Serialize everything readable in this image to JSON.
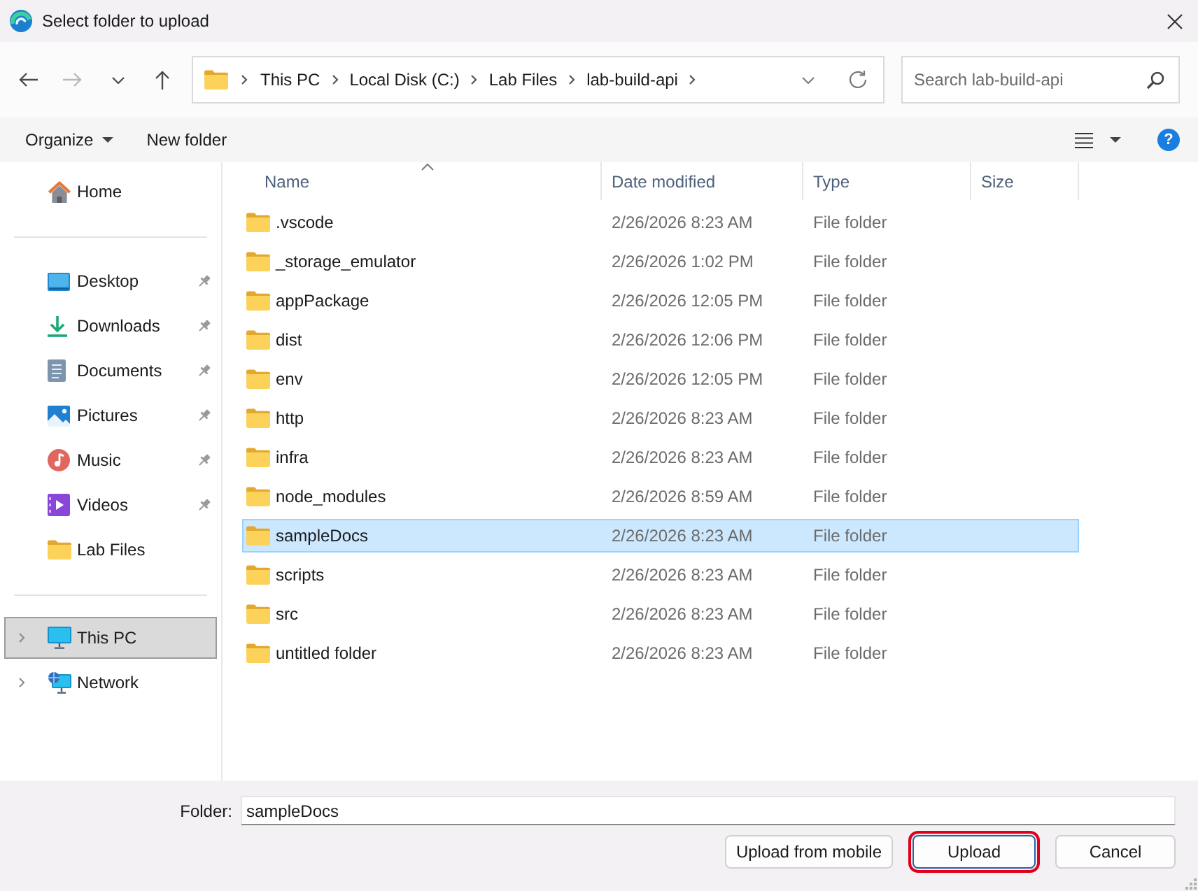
{
  "window": {
    "title": "Select folder to upload"
  },
  "nav_buttons": [
    {
      "kind": "back",
      "disabled": false
    },
    {
      "kind": "forward",
      "disabled": true
    },
    {
      "kind": "recent",
      "disabled": false
    },
    {
      "kind": "up",
      "disabled": false
    }
  ],
  "address_bar": {
    "breadcrumbs": [
      "This PC",
      "Local Disk (C:)",
      "Lab Files",
      "lab-build-api"
    ]
  },
  "search": {
    "placeholder": "Search lab-build-api"
  },
  "command_bar": {
    "items": [
      {
        "label": "Organize",
        "kind": "menu"
      },
      {
        "label": "New folder",
        "kind": "button"
      }
    ],
    "help": {
      "label": "?"
    }
  },
  "sidebar": {
    "sections": [
      {
        "items": [
          {
            "label": "Home",
            "selected": false
          }
        ]
      },
      {
        "items": [
          {
            "label": "Desktop",
            "pinned": true,
            "selected": false
          },
          {
            "label": "Downloads",
            "pinned": true,
            "selected": false
          },
          {
            "label": "Documents",
            "pinned": true,
            "selected": false
          },
          {
            "label": "Pictures",
            "pinned": true,
            "selected": false
          },
          {
            "label": "Music",
            "pinned": true,
            "selected": false
          },
          {
            "label": "Videos",
            "pinned": true,
            "selected": false
          },
          {
            "label": "Lab Files",
            "pinned": false,
            "selected": false
          }
        ]
      },
      {
        "items": [
          {
            "label": "This PC",
            "expanded": false,
            "selected": true
          },
          {
            "label": "Network",
            "expanded": false,
            "selected": false
          }
        ]
      }
    ]
  },
  "file_list": {
    "columns": [
      {
        "label": "Name",
        "sorted": true
      },
      {
        "label": "Date modified",
        "sorted": false
      },
      {
        "label": "Type",
        "sorted": false
      },
      {
        "label": "Size",
        "sorted": false
      }
    ],
    "rows": [
      {
        "name": ".vscode",
        "date_modified": "2/26/2026 8:23 AM",
        "type": "File folder",
        "selected": false
      },
      {
        "name": "_storage_emulator",
        "date_modified": "2/26/2026 1:02 PM",
        "type": "File folder",
        "selected": false
      },
      {
        "name": "appPackage",
        "date_modified": "2/26/2026 12:05 PM",
        "type": "File folder",
        "selected": false
      },
      {
        "name": "dist",
        "date_modified": "2/26/2026 12:06 PM",
        "type": "File folder",
        "selected": false
      },
      {
        "name": "env",
        "date_modified": "2/26/2026 12:05 PM",
        "type": "File folder",
        "selected": false
      },
      {
        "name": "http",
        "date_modified": "2/26/2026 8:23 AM",
        "type": "File folder",
        "selected": false
      },
      {
        "name": "infra",
        "date_modified": "2/26/2026 8:23 AM",
        "type": "File folder",
        "selected": false
      },
      {
        "name": "node_modules",
        "date_modified": "2/26/2026 8:59 AM",
        "type": "File folder",
        "selected": false
      },
      {
        "name": "sampleDocs",
        "date_modified": "2/26/2026 8:23 AM",
        "type": "File folder",
        "selected": true
      },
      {
        "name": "scripts",
        "date_modified": "2/26/2026 8:23 AM",
        "type": "File folder",
        "selected": false
      },
      {
        "name": "src",
        "date_modified": "2/26/2026 8:23 AM",
        "type": "File folder",
        "selected": false
      },
      {
        "name": "untitled folder",
        "date_modified": "2/26/2026 8:23 AM",
        "type": "File folder",
        "selected": false
      }
    ]
  },
  "footer": {
    "folder_field": {
      "label": "Folder:",
      "value": "sampleDocs"
    },
    "buttons": [
      {
        "label": "Upload from mobile",
        "default": false,
        "highlighted": false
      },
      {
        "label": "Upload",
        "default": true,
        "highlighted": true
      },
      {
        "label": "Cancel",
        "default": false,
        "highlighted": false
      }
    ]
  }
}
